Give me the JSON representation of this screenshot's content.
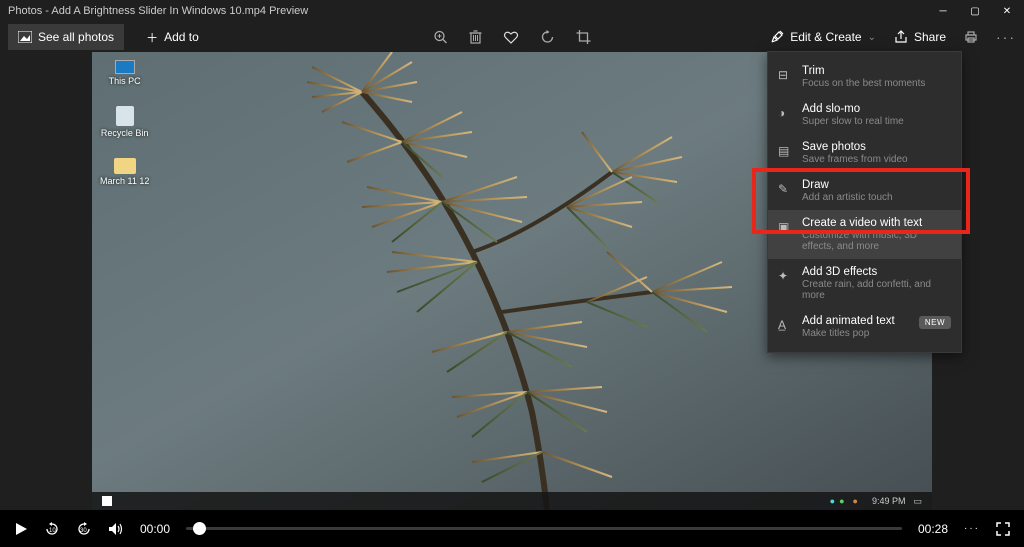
{
  "title": "Photos - Add A Brightness Slider In Windows 10.mp4 Preview",
  "toolbar": {
    "see_all": "See all photos",
    "add_to": "Add to",
    "edit_create": "Edit & Create",
    "share": "Share"
  },
  "desktop": {
    "icon1": "This PC",
    "icon2": "Recycle Bin",
    "icon3": "March 11 12"
  },
  "inner_taskbar": {
    "time": "9:49 PM"
  },
  "dropdown": {
    "items": [
      {
        "title": "Trim",
        "sub": "Focus on the best moments"
      },
      {
        "title": "Add slo-mo",
        "sub": "Super slow to real time"
      },
      {
        "title": "Save photos",
        "sub": "Save frames from video"
      },
      {
        "title": "Draw",
        "sub": "Add an artistic touch"
      },
      {
        "title": "Create a video with text",
        "sub": "Customize with music, 3D effects, and more"
      },
      {
        "title": "Add 3D effects",
        "sub": "Create rain, add confetti, and more"
      },
      {
        "title": "Add animated text",
        "sub": "Make titles pop",
        "badge": "NEW"
      }
    ]
  },
  "player": {
    "current": "00:00",
    "total": "00:28"
  }
}
